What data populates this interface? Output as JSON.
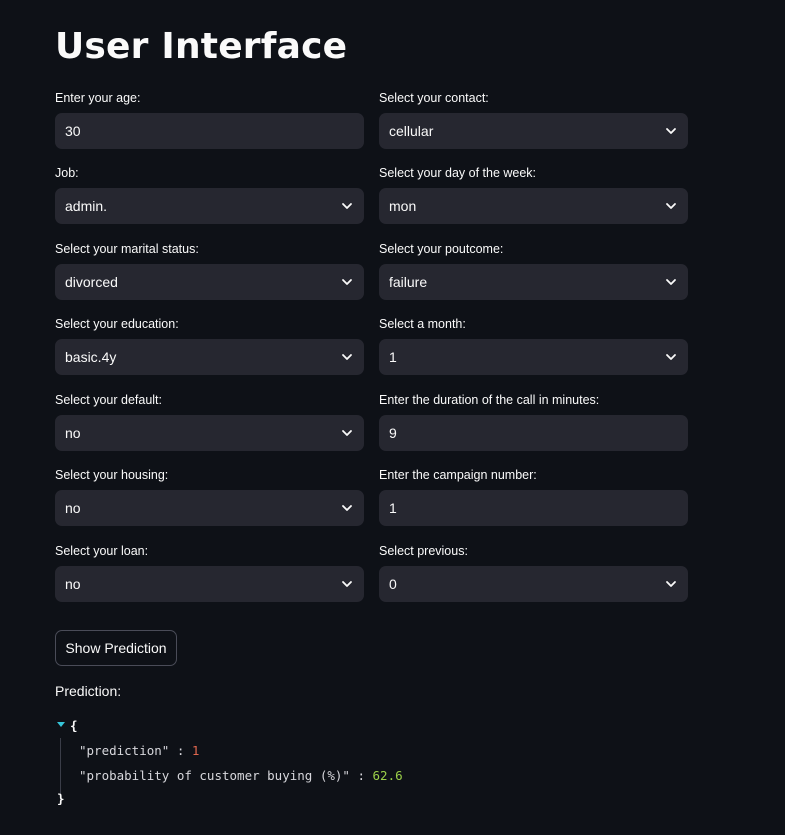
{
  "title": "User Interface",
  "left_column": [
    {
      "label": "Enter your age:",
      "value": "30",
      "kind": "input"
    },
    {
      "label": "Job:",
      "value": "admin.",
      "kind": "select"
    },
    {
      "label": "Select your marital status:",
      "value": "divorced",
      "kind": "select"
    },
    {
      "label": "Select your education:",
      "value": "basic.4y",
      "kind": "select"
    },
    {
      "label": "Select your default:",
      "value": "no",
      "kind": "select"
    },
    {
      "label": "Select your housing:",
      "value": "no",
      "kind": "select"
    },
    {
      "label": "Select your loan:",
      "value": "no",
      "kind": "select"
    }
  ],
  "right_column": [
    {
      "label": "Select your contact:",
      "value": "cellular",
      "kind": "select"
    },
    {
      "label": "Select your day of the week:",
      "value": "mon",
      "kind": "select"
    },
    {
      "label": "Select your poutcome:",
      "value": "failure",
      "kind": "select"
    },
    {
      "label": "Select a month:",
      "value": "1",
      "kind": "select"
    },
    {
      "label": "Enter the duration of the call in minutes:",
      "value": "9",
      "kind": "input"
    },
    {
      "label": "Enter the campaign number:",
      "value": "1",
      "kind": "input"
    },
    {
      "label": "Select previous:",
      "value": "0",
      "kind": "select"
    }
  ],
  "button": {
    "label": "Show Prediction"
  },
  "prediction": {
    "label": "Prediction:",
    "open_brace": "{",
    "close_brace": "}",
    "entries": [
      {
        "key": "\"prediction\"",
        "sep": ":",
        "value": "1",
        "value_color": "#e0674f"
      },
      {
        "key": "\"probability of customer buying (%)\"",
        "sep": ":",
        "value": "62.6",
        "value_color": "#9bd049"
      }
    ]
  },
  "colors": {
    "background": "#0e1117",
    "control_bg": "#262730",
    "text": "#fafafa",
    "caret": "#36c5d9"
  },
  "icons": {
    "select_indicator": "chevron-down-icon",
    "json_toggle": "caret-down-icon"
  }
}
